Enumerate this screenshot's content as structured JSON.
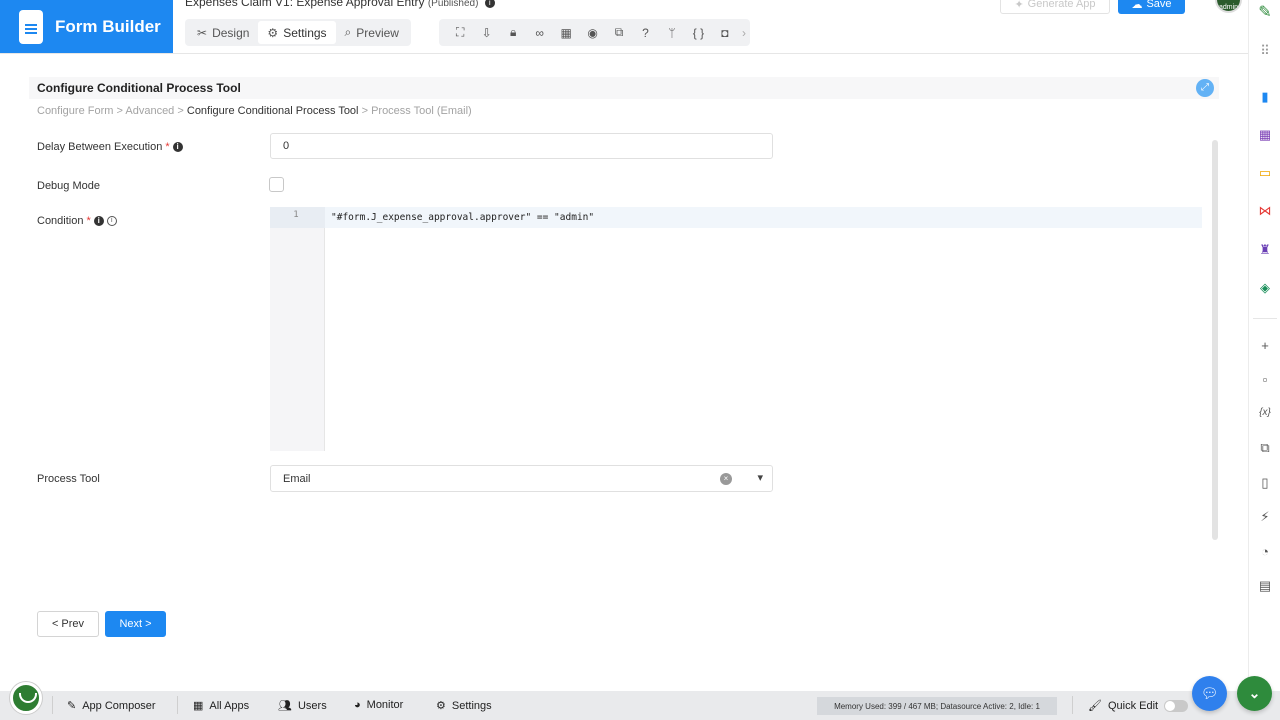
{
  "app": {
    "brand_title": "Form Builder",
    "form_name": "Expenses Claim V1: Expense Approval Entry",
    "form_status": "(Published)"
  },
  "header": {
    "tabs": [
      {
        "label": "Design",
        "icon": "design-icon",
        "active": false
      },
      {
        "label": "Settings",
        "icon": "gear-icon",
        "active": true
      },
      {
        "label": "Preview",
        "icon": "preview-icon",
        "active": false
      }
    ],
    "generate_app_label": "Generate App",
    "save_label": "Save",
    "avatar_text": "admin",
    "toolbar_icons": [
      "sitemap-icon",
      "import-icon",
      "lock-icon",
      "binoculars-icon",
      "table-icon",
      "eye-icon",
      "translate-icon",
      "help-icon",
      "branch-icon",
      "json-icon",
      "camera-icon",
      "chevron-right-icon"
    ]
  },
  "panel": {
    "title": "Configure Conditional Process Tool",
    "breadcrumb": {
      "item1": "Configure Form",
      "sep": ">",
      "item2": "Advanced",
      "item3": "Configure Conditional Process Tool",
      "item4": "Process Tool (Email)"
    }
  },
  "form": {
    "delay": {
      "label": "Delay Between Execution",
      "required": "*",
      "value": "0"
    },
    "debug": {
      "label": "Debug Mode",
      "checked": false
    },
    "condition": {
      "label": "Condition",
      "required": "*",
      "line_number": "1",
      "code": "\"#form.J_expense_approval.approver\" == \"admin\""
    },
    "process_tool": {
      "label": "Process Tool",
      "value": "Email"
    }
  },
  "nav": {
    "prev_label": "< Prev",
    "next_label": "Next >"
  },
  "bottom_bar": {
    "app_composer": "App Composer",
    "all_apps": "All Apps",
    "users": "Users",
    "monitor": "Monitor",
    "settings": "Settings",
    "memory": "Memory Used: 399 / 467 MB; Datasource Active: 2, Idle: 1",
    "quick_edit": "Quick Edit"
  },
  "colors": {
    "brand_blue": "#1d88f1",
    "joget_green": "#2e8b3c",
    "chat_blue": "#2f80ed"
  },
  "right_sidebar_icons": [
    "edit-icon",
    "drag-handle-icon",
    "document-icon",
    "table-grid-icon",
    "monitor-icon",
    "process-flow-icon",
    "robot-icon",
    "paint-bucket-icon",
    "plus-icon",
    "sticky-note-icon",
    "variable-icon",
    "translate-icon",
    "file-icon",
    "plug-icon",
    "gauge-icon",
    "log-icon"
  ]
}
